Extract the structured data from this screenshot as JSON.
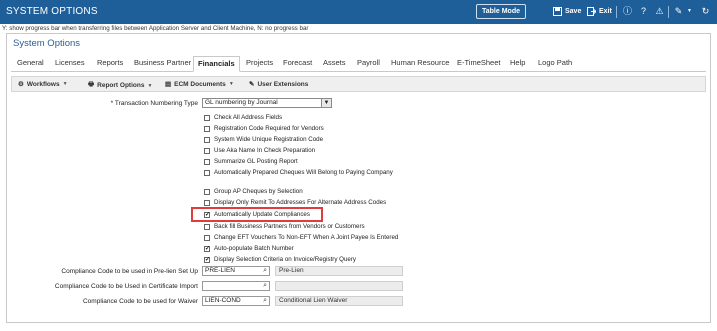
{
  "window": {
    "title": "SYSTEM OPTIONS",
    "table_mode_label": "Table Mode",
    "save_label": "Save",
    "exit_label": "Exit"
  },
  "hint_text": "Y: show progress bar when transferring files between Application Server and Client Machine, N: no progress bar",
  "panel": {
    "title": "System Options"
  },
  "tabs": [
    {
      "label": "General"
    },
    {
      "label": "Licenses"
    },
    {
      "label": "Reports"
    },
    {
      "label": "Business Partner"
    },
    {
      "label": "Financials",
      "active": true
    },
    {
      "label": "Projects"
    },
    {
      "label": "Forecast"
    },
    {
      "label": "Assets"
    },
    {
      "label": "Payroll"
    },
    {
      "label": "Human Resource"
    },
    {
      "label": "E-TimeSheet"
    },
    {
      "label": "Help"
    },
    {
      "label": "Logo Path"
    }
  ],
  "toolbar": {
    "workflows": "Workflows",
    "report_options": "Report Options",
    "ecm_documents": "ECM Documents",
    "user_extensions": "User Extensions"
  },
  "form": {
    "numbering_label": "* Transaction Numbering Type",
    "numbering_value": "GL numbering by Journal",
    "checkboxes": [
      {
        "label": "Check All Address Fields",
        "checked": false
      },
      {
        "label": "Registration Code Required for Vendors",
        "checked": false
      },
      {
        "label": "System Wide Unique Registration Code",
        "checked": false
      },
      {
        "label": "Use Aka Name In Check Preparation",
        "checked": false
      },
      {
        "label": "Summarize GL Posting Report",
        "checked": false
      },
      {
        "label": "Automatically Prepared Cheques Will Belong to Paying Company",
        "checked": false
      },
      {
        "label": "Group AP Cheques by Selection",
        "checked": false
      },
      {
        "label": "Display Only Remit To Addresses For Alternate Address Codes",
        "checked": false
      },
      {
        "label": "Automatically Update Compliances",
        "checked": true
      },
      {
        "label": "Back fill Business Partners from Vendors or Customers",
        "checked": false
      },
      {
        "label": "Change EFT Vouchers To Non-EFT When A Joint Payee Is Entered",
        "checked": false
      },
      {
        "label": "Auto-populate Batch Number",
        "checked": true
      },
      {
        "label": "Display Selection Criteria on Invoice/Registry Query",
        "checked": true
      }
    ],
    "compliance": [
      {
        "label": "Compliance Code to be used in Pre-lien Set Up",
        "code": "PRE-LIEN",
        "desc": "Pre-Lien"
      },
      {
        "label": "Compliance Code to be Used in Certificate Import",
        "code": "",
        "desc": ""
      },
      {
        "label": "Compliance Code to be used for Waiver",
        "code": "LIEN-COND",
        "desc": "Conditional Lien Waiver"
      }
    ]
  }
}
